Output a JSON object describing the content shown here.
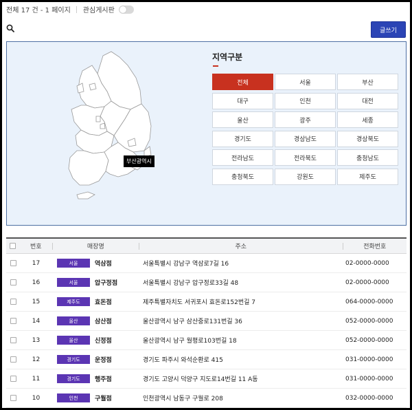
{
  "top": {
    "summary": "전체 17 건 - 1 페이지",
    "favorite_label": "관심게시판"
  },
  "write_button": "글쓰기",
  "map": {
    "tooltip": "부산광역시",
    "land_color": "#ffffff",
    "border_color": "#999999"
  },
  "region": {
    "title": "지역구분",
    "buttons": [
      "전체",
      "서울",
      "부산",
      "대구",
      "인천",
      "대전",
      "울산",
      "광주",
      "세종",
      "경기도",
      "경상남도",
      "경상북도",
      "전라남도",
      "전라북도",
      "충청남도",
      "충청북도",
      "강원도",
      "제주도"
    ],
    "active": "전체",
    "active_color": "#c8311f"
  },
  "table": {
    "headers": {
      "num": "번호",
      "name": "매장명",
      "addr": "주소",
      "tel": "전화번호"
    },
    "tag_color": "#5b35b3",
    "rows": [
      {
        "num": "17",
        "tag": "서울",
        "name": "역삼점",
        "addr": "서울특별시 강남구 역삼로7길 16",
        "tel": "02-0000-0000"
      },
      {
        "num": "16",
        "tag": "서울",
        "name": "압구정점",
        "addr": "서울특별시 강남구 압구정로33길 48",
        "tel": "02-0000-0000"
      },
      {
        "num": "15",
        "tag": "제주도",
        "name": "효돈점",
        "addr": "제주특별자치도 서귀포시 효돈로152번길 7",
        "tel": "064-0000-0000"
      },
      {
        "num": "14",
        "tag": "울산",
        "name": "삼산점",
        "addr": "울산광역시 남구 삼산중로131번길 36",
        "tel": "052-0000-0000"
      },
      {
        "num": "13",
        "tag": "울산",
        "name": "신정점",
        "addr": "울산광역시 남구 월평로103번길 18",
        "tel": "052-0000-0000"
      },
      {
        "num": "12",
        "tag": "경기도",
        "name": "운정점",
        "addr": "경기도 파주시 와석순환로 415",
        "tel": "031-0000-0000"
      },
      {
        "num": "11",
        "tag": "경기도",
        "name": "행주점",
        "addr": "경기도 고양시 덕양구 지도로14번길 11 A동",
        "tel": "031-0000-0000"
      },
      {
        "num": "10",
        "tag": "인천",
        "name": "구월점",
        "addr": "인천광역시 남동구 구월로 208",
        "tel": "032-0000-0000"
      }
    ]
  }
}
